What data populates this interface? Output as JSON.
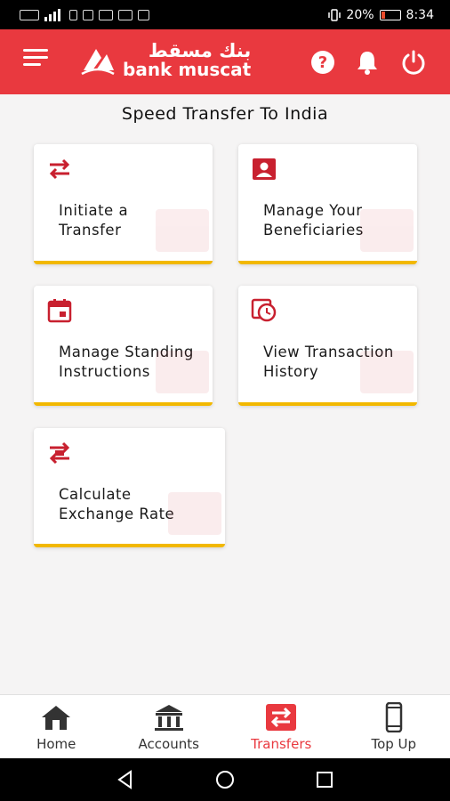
{
  "status_bar": {
    "battery": "20%",
    "time": "8:34"
  },
  "header": {
    "logo_arabic": "بنك مسقط",
    "logo_english": "bank muscat"
  },
  "page": {
    "title": "Speed Transfer To India"
  },
  "cards": [
    {
      "line1": "Initiate a",
      "line2": "Transfer"
    },
    {
      "line1": "Manage Your",
      "line2": "Beneficiaries"
    },
    {
      "line1": "Manage Standing",
      "line2": "Instructions"
    },
    {
      "line1": "View Transaction",
      "line2": "History"
    },
    {
      "line1": "Calculate",
      "line2": "Exchange Rate"
    }
  ],
  "bottom_nav": [
    {
      "label": "Home",
      "icon": "home-icon"
    },
    {
      "label": "Accounts",
      "icon": "bank-icon"
    },
    {
      "label": "Transfers",
      "icon": "transfer-icon",
      "active": true
    },
    {
      "label": "Top Up",
      "icon": "phone-icon"
    }
  ],
  "colors": {
    "brand_red": "#e9393f",
    "card_accent": "#f2b800",
    "icon_red": "#c8202f"
  }
}
